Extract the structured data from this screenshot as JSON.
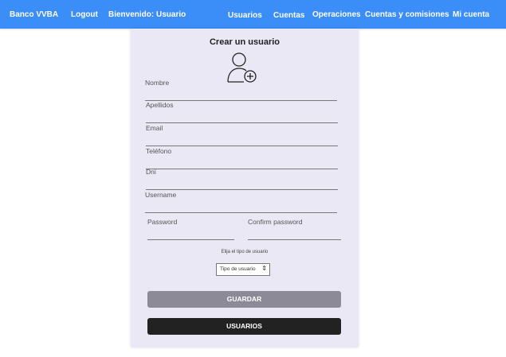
{
  "navbar": {
    "brand": "Banco VVBA",
    "logout": "Logout",
    "welcome": "Bienvenido: Usuario",
    "links": [
      "Usuarios",
      "Cuentas",
      "Operaciones",
      "Cuentas y comisiones",
      "Mi cuenta"
    ]
  },
  "form": {
    "title": "Crear un usuario",
    "icon": "user-add-icon",
    "fields": {
      "nombre": "Nombre",
      "apellidos": "Apellidos",
      "email": "Email",
      "telefono": "Teléfono",
      "dni": "Dni",
      "username": "Username",
      "password": "Password",
      "confirm_password": "Confirm password"
    },
    "type_label": "Elija el tipo de usuario",
    "type_select_value": "Tipo de usuario",
    "save_button": "GUARDAR",
    "users_button": "USUARIOS"
  },
  "colors": {
    "navbar": "#3b8df7",
    "card": "#ebe8f6",
    "save_button": "#8c8a96",
    "users_button": "#222222"
  }
}
